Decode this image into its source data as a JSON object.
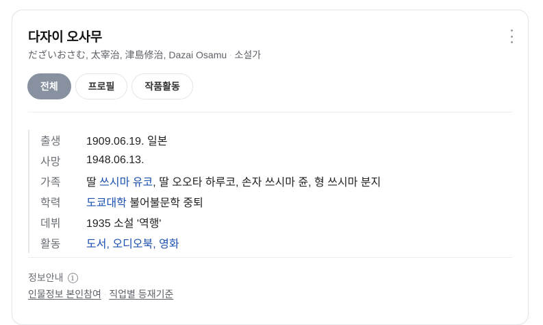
{
  "profile": {
    "name": "다자이 오사무",
    "aliases": "だざいおさむ, 太宰治, 津島修治, Dazai Osamu",
    "occupation": "소설가",
    "subtitle_separator": "·"
  },
  "tabs": [
    {
      "label": "전체",
      "active": true
    },
    {
      "label": "프로필",
      "active": false
    },
    {
      "label": "작품활동",
      "active": false
    }
  ],
  "info": {
    "birth": {
      "label": "출생",
      "value": "1909.06.19. 일본"
    },
    "death": {
      "label": "사망",
      "value": "1948.06.13."
    },
    "family": {
      "label": "가족",
      "prefix": "딸 ",
      "link1": "쓰시마 유코",
      "rest": ", 딸 오오타 하루코, 손자 쓰시마 쥰, 형 쓰시마 분지"
    },
    "education": {
      "label": "학력",
      "link": "도쿄대학",
      "rest": " 불어불문학 중퇴"
    },
    "debut": {
      "label": "데뷔",
      "value": "1935 소설 '역행'"
    },
    "activity": {
      "label": "활동",
      "links": [
        "도서",
        "오디오북",
        "영화"
      ],
      "separator": ", "
    }
  },
  "footer": {
    "title": "정보안내",
    "info_icon_glyph": "i",
    "links": [
      "인물정보 본인참여",
      "직업별 등재기준"
    ],
    "separator": "·"
  },
  "colors": {
    "active_tab": "#8791a0",
    "link": "#1a4fb0"
  },
  "icons": {
    "more": "more-vertical-icon",
    "info": "info-circle-icon"
  }
}
